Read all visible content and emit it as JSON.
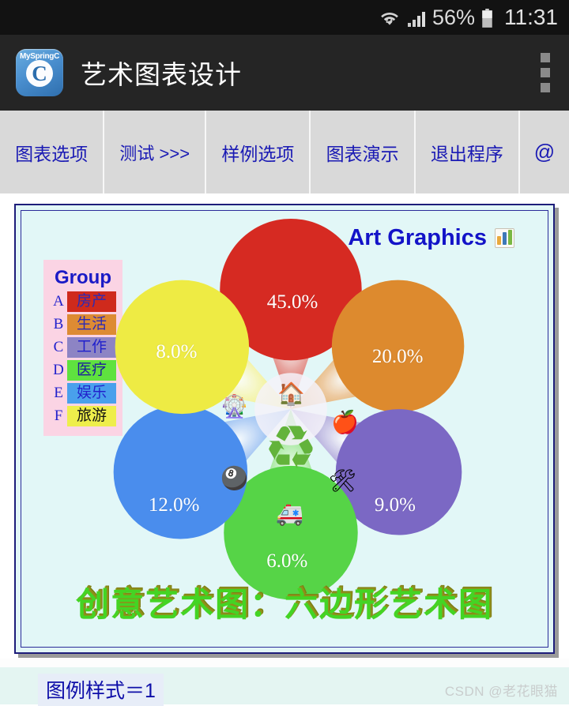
{
  "status_bar": {
    "wifi_icon": "wifi-icon",
    "signal_icon": "signal-bars-icon",
    "battery_percent": "56%",
    "battery_icon": "battery-icon",
    "time": "11:31"
  },
  "app_bar": {
    "logo_top_text": "MySpringC",
    "logo_letter": "C",
    "title": "艺术图表设计",
    "overflow_icon": "overflow-menu-icon"
  },
  "menu": {
    "items": [
      {
        "label": "图表选项"
      },
      {
        "label": "测试 >>>"
      },
      {
        "label": "样例选项"
      },
      {
        "label": "图表演示"
      },
      {
        "label": "退出程序"
      },
      {
        "label": "@"
      }
    ]
  },
  "panel": {
    "brand_title": "Art Graphics",
    "brand_icon": "bar-chart-icon",
    "chart_title": "创意艺术图：六边形艺术图",
    "background_color": "#e2f7f7",
    "border_color": "#1d1d7a"
  },
  "legend": {
    "heading": "Group",
    "background_color": "#fbd4e4",
    "items": [
      {
        "key": "A",
        "label": "房产",
        "color": "#cf2a1c",
        "text_color": "#2a2ab8"
      },
      {
        "key": "B",
        "label": "生活",
        "color": "#dd8b33",
        "text_color": "#2a2ab8"
      },
      {
        "key": "C",
        "label": "工作",
        "color": "#8d84c4",
        "text_color": "#2020cc"
      },
      {
        "key": "D",
        "label": "医疗",
        "color": "#5fe23f",
        "text_color": "#1b1b9c"
      },
      {
        "key": "E",
        "label": "娱乐",
        "color": "#49a0ec",
        "text_color": "#2222cc"
      },
      {
        "key": "F",
        "label": "旅游",
        "color": "#eeee4b",
        "text_color": "#111111"
      }
    ]
  },
  "chart_data": {
    "type": "pie",
    "title": "创意艺术图：六边形艺术图",
    "style": "hexagonal flower / petal art chart",
    "center_icon": "recycle-icon",
    "legend_position": "left",
    "categories": [
      "房产",
      "生活",
      "工作",
      "医疗",
      "娱乐",
      "旅游"
    ],
    "values": [
      45.0,
      20.0,
      9.0,
      6.0,
      12.0,
      8.0
    ],
    "labels": [
      "45.0%",
      "20.0%",
      "9.0%",
      "6.0%",
      "12.0%",
      "8.0%"
    ],
    "series": [
      {
        "name": "Group",
        "points": [
          {
            "key": "A",
            "category": "房产",
            "value": 45.0,
            "label": "45.0%",
            "color": "#d62a22",
            "angle_deg": 90,
            "icon": "house-icon",
            "icon_glyph": "🏠"
          },
          {
            "key": "B",
            "category": "生活",
            "value": 20.0,
            "label": "20.0%",
            "color": "#dd8a2e",
            "angle_deg": 30,
            "icon": "apple-icon",
            "icon_glyph": "🍎"
          },
          {
            "key": "C",
            "category": "工作",
            "value": 9.0,
            "label": "9.0%",
            "color": "#7b68c4",
            "angle_deg": -30,
            "icon": "tools-icon",
            "icon_glyph": "🛠"
          },
          {
            "key": "D",
            "category": "医疗",
            "value": 6.0,
            "label": "6.0%",
            "color": "#56d447",
            "angle_deg": -90,
            "icon": "ambulance-icon",
            "icon_glyph": "🚑"
          },
          {
            "key": "E",
            "category": "娱乐",
            "value": 12.0,
            "label": "12.0%",
            "color": "#4a8ded",
            "angle_deg": 210,
            "icon": "billiards-icon",
            "icon_glyph": "🎱"
          },
          {
            "key": "F",
            "category": "旅游",
            "value": 8.0,
            "label": "8.0%",
            "color": "#eeeb44",
            "angle_deg": 150,
            "icon": "ferris-wheel-icon",
            "icon_glyph": "🎡"
          }
        ]
      }
    ]
  },
  "footer": {
    "status_text": "图例样式＝1",
    "watermark": "CSDN @老花眼猫"
  }
}
